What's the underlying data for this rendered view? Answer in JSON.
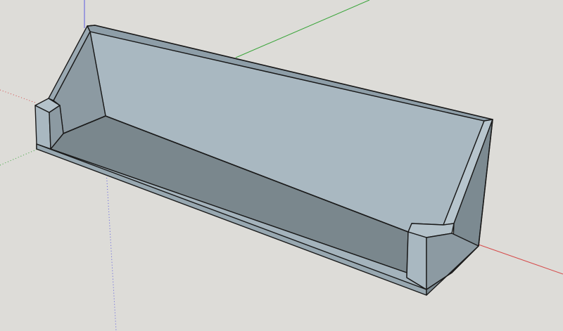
{
  "viewport": {
    "background": "#dddcd8"
  },
  "axes": {
    "red": "#d64b4b",
    "green": "#3aa53a",
    "blue": "#5a5adf"
  },
  "model": {
    "face_light": "#a9b8c1",
    "face_mid": "#9aaab4",
    "face_dark": "#7c8a91",
    "face_floor": "#7a878d",
    "edge": "#1a1a1a"
  }
}
